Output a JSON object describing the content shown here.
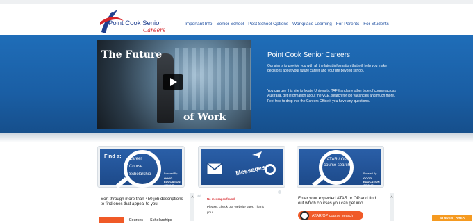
{
  "header": {
    "logo_main": "Point Cook Senior",
    "logo_sub": "Careers",
    "nav": [
      "Important Info",
      "Senior School",
      "Post School Options",
      "Workplace Learning",
      "For Parents",
      "For Students"
    ]
  },
  "banner": {
    "video_title_1": "The Future",
    "video_title_2": "of Work",
    "title": "Point Cook Senior Careers",
    "para1": "Our aim is to provide you with all the latest information that will help you make decisions about your future career and your life beyond school.",
    "para2": "You can use this site to locate University, TAFE and any other type of course across Australia, get information about the VCE, search for job vacancies and much more. Feel free to drop into the Careers Office if you have any questions."
  },
  "tiles": {
    "find_label": "Find a:",
    "find_items": [
      "Career",
      "Course",
      "Scholarship"
    ],
    "powered_by": "Powered By:",
    "good_education": "GOOD EDUCATION GROUP",
    "messages_label": "Messages",
    "atar_label": "ATAR / OP course search"
  },
  "panels": {
    "career_text": "Sort through more than 450 job descriptions to find ones that appeal to you.",
    "tabs": [
      "Careers",
      "Courses",
      "Scholarships"
    ],
    "no_messages": "No messages found",
    "message_body": "Please, check our website later. Thank you.",
    "atar_text": "Enter your expected ATAR or OP and find out which courses you can get into.",
    "atar_button": "ATAR/OP course search"
  },
  "student_area": "STUDENT AREA",
  "colors": {
    "brand_blue": "#1f6db8",
    "accent_orange": "#f05a28",
    "student_orange": "#f59a20"
  }
}
